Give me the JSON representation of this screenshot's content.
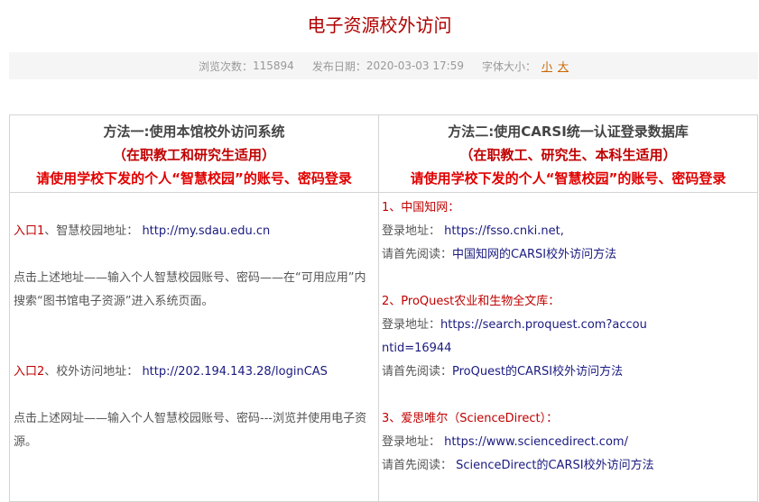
{
  "page": {
    "title": "电子资源校外访问"
  },
  "meta": {
    "views_label": "浏览次数：",
    "views_value": "115894",
    "date_label": "发布日期：",
    "date_value": "2020-03-03 17:59",
    "font_size_label": "字体大小：",
    "font_small": "小",
    "font_large": "大"
  },
  "method1": {
    "title": "方法一:使用本馆校外访问系统",
    "scope": "（在职教工和研究生适用）",
    "login_note": "请使用学校下发的个人“智慧校园”的账号、密码登录",
    "entry1_prefix": "入口1",
    "entry1_label": "、智慧校园地址：",
    "entry1_url": "http://my.sdau.edu.cn",
    "entry1_desc": "点击上述地址——输入个人智慧校园账号、密码——在“可用应用”内搜索“图书馆电子资源”进入系统页面。",
    "entry2_prefix": "入口2",
    "entry2_label": "、校外访问地址：",
    "entry2_url": "http://202.194.143.28/loginCAS",
    "entry2_desc": "点击上述网址——输入个人智慧校园账号、密码---浏览并使用电子资源。"
  },
  "method2": {
    "title": "方法二:使用CARSI统一认证登录数据库",
    "scope": "（在职教工、研究生、本科生适用）",
    "login_note": "请使用学校下发的个人“智慧校园”的账号、密码登录",
    "items": [
      {
        "heading": "1、中国知网：",
        "login_label": "登录地址：",
        "login_url": "https://fsso.cnki.net,",
        "read_label": "请首先阅读：",
        "read_link": "中国知网的CARSI校外访问方法"
      },
      {
        "heading": "2、ProQuest农业和生物全文库：",
        "login_label": "登录地址：",
        "login_url": "https://search.proquest.com?accountid=16944",
        "read_label": "请首先阅读：",
        "read_link": "ProQuest的CARSI校外访问方法"
      },
      {
        "heading": "3、爱思唯尔（ScienceDirect）：",
        "login_label": "登录地址：",
        "login_url": "https://www.sciencedirect.com/",
        "read_label": "请首先阅读：",
        "read_link": "ScienceDirect的CARSI校外访问方法"
      }
    ]
  }
}
